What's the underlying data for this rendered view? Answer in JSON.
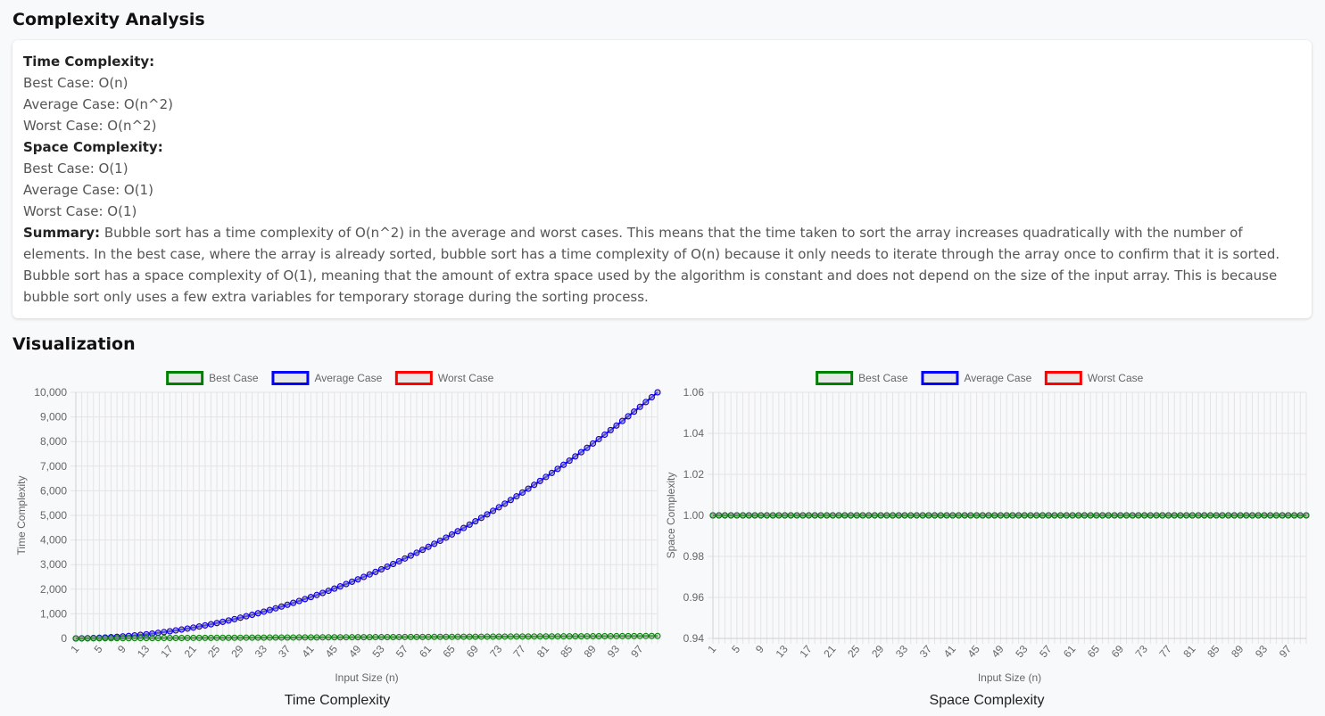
{
  "page": {
    "analysis_title": "Complexity Analysis",
    "visualization_title": "Visualization"
  },
  "analysis": {
    "time_label": "Time Complexity:",
    "time_best": "Best Case: O(n)",
    "time_average": "Average Case: O(n^2)",
    "time_worst": "Worst Case: O(n^2)",
    "space_label": "Space Complexity:",
    "space_best": "Best Case: O(1)",
    "space_average": "Average Case: O(1)",
    "space_worst": "Worst Case: O(1)",
    "summary_label": "Summary:",
    "summary_text": "Bubble sort has a time complexity of O(n^2) in the average and worst cases. This means that the time taken to sort the array increases quadratically with the number of elements. In the best case, where the array is already sorted, bubble sort has a time complexity of O(n) because it only needs to iterate through the array once to confirm that it is sorted. Bubble sort has a space complexity of O(1), meaning that the amount of extra space used by the algorithm is constant and does not depend on the size of the input array. This is because bubble sort only uses a few extra variables for temporary storage during the sorting process."
  },
  "colors": {
    "best": "#008000",
    "average": "#0000ff",
    "worst": "#ff0000"
  },
  "chart_data": [
    {
      "type": "line",
      "title": "Time Complexity",
      "xlabel": "Input Size (n)",
      "ylabel": "Time Complexity",
      "x_range": [
        1,
        100
      ],
      "x_tick_labels": [
        "1",
        "5",
        "9",
        "13",
        "17",
        "21",
        "25",
        "29",
        "33",
        "37",
        "41",
        "45",
        "49",
        "53",
        "57",
        "61",
        "65",
        "69",
        "73",
        "77",
        "81",
        "85",
        "89",
        "93",
        "97"
      ],
      "y_ticks": [
        0,
        1000,
        2000,
        3000,
        4000,
        5000,
        6000,
        7000,
        8000,
        9000,
        10000
      ],
      "y_tick_labels": [
        "0",
        "1,000",
        "2,000",
        "3,000",
        "4,000",
        "5,000",
        "6,000",
        "7,000",
        "8,000",
        "9,000",
        "10,000"
      ],
      "ylim": [
        0,
        10000
      ],
      "grid": true,
      "legend_position": "top",
      "series": [
        {
          "name": "Best Case",
          "formula": "n",
          "color": "#008000"
        },
        {
          "name": "Average Case",
          "formula": "n^2",
          "color": "#0000ff"
        },
        {
          "name": "Worst Case",
          "formula": "n^2",
          "color": "#ff0000"
        }
      ]
    },
    {
      "type": "line",
      "title": "Space Complexity",
      "xlabel": "Input Size (n)",
      "ylabel": "Space Complexity",
      "x_range": [
        1,
        100
      ],
      "x_tick_labels": [
        "1",
        "5",
        "9",
        "13",
        "17",
        "21",
        "25",
        "29",
        "33",
        "37",
        "41",
        "45",
        "49",
        "53",
        "57",
        "61",
        "65",
        "69",
        "73",
        "77",
        "81",
        "85",
        "89",
        "93",
        "97"
      ],
      "y_ticks": [
        0.94,
        0.96,
        0.98,
        1.0,
        1.02,
        1.04,
        1.06
      ],
      "y_tick_labels": [
        "0.94",
        "0.96",
        "0.98",
        "1.00",
        "1.02",
        "1.04",
        "1.06"
      ],
      "ylim": [
        0.94,
        1.06
      ],
      "grid": true,
      "legend_position": "top",
      "series": [
        {
          "name": "Best Case",
          "formula": "1",
          "color": "#008000"
        },
        {
          "name": "Average Case",
          "formula": "1",
          "color": "#0000ff"
        },
        {
          "name": "Worst Case",
          "formula": "1",
          "color": "#ff0000"
        }
      ]
    }
  ]
}
